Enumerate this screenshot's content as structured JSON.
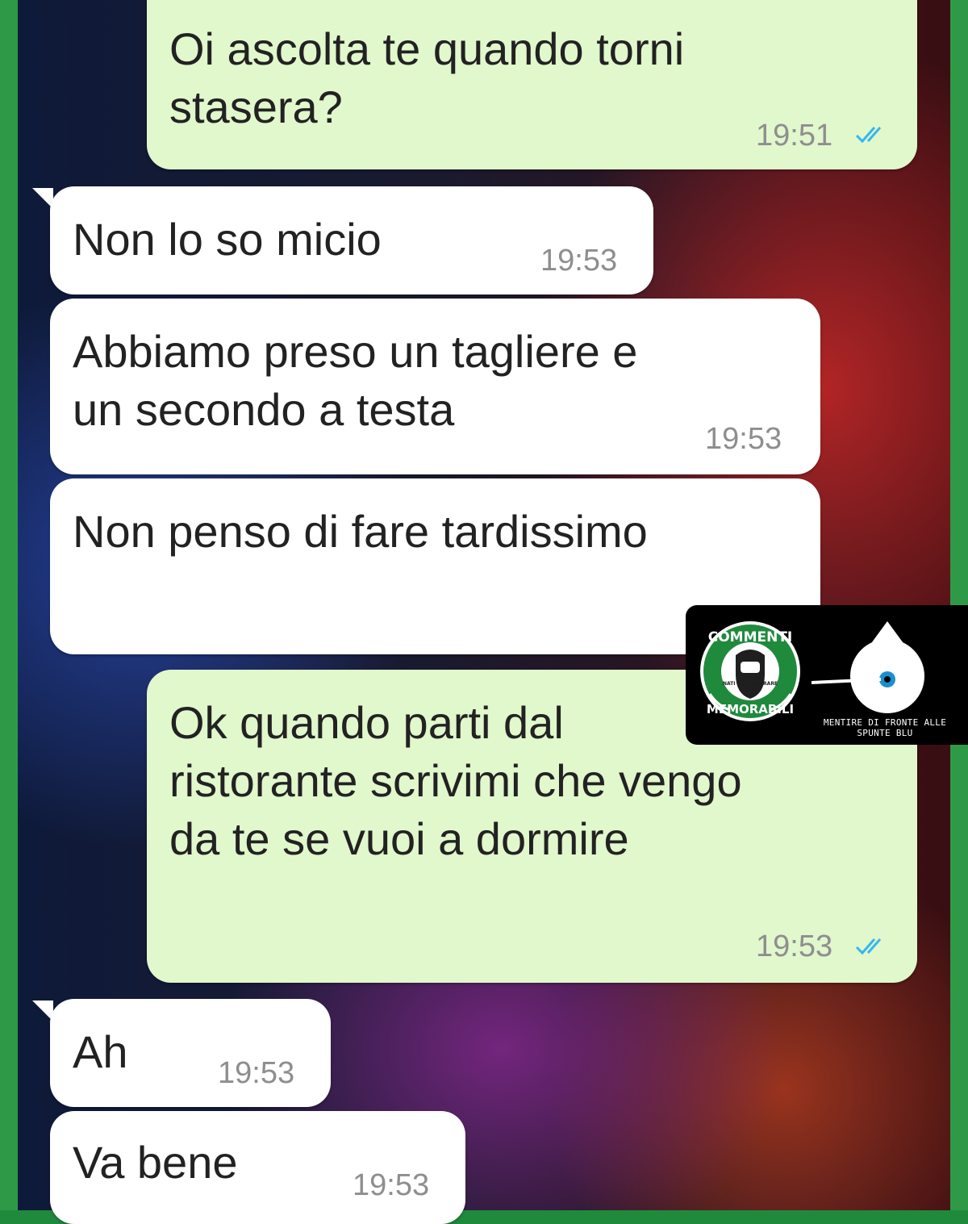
{
  "messages": [
    {
      "direction": "outgoing",
      "text": "Oi ascolta te quando torni\nstasera?",
      "time": "19:51",
      "read_ticks": "double-check-blue-icon"
    },
    {
      "direction": "incoming",
      "text": "Non lo so micio",
      "time": "19:53"
    },
    {
      "direction": "incoming",
      "text": "Abbiamo preso un tagliere e\nun secondo a testa",
      "time": "19:53"
    },
    {
      "direction": "incoming",
      "text": "Non penso di fare tardissimo",
      "time": ""
    },
    {
      "direction": "outgoing",
      "text": "Ok quando parti dal\nristorante scrivimi che vengo\nda te se vuoi a dormire",
      "time": "19:53",
      "read_ticks": "double-check-blue-icon"
    },
    {
      "direction": "incoming",
      "text": "Ah",
      "time": "19:53"
    },
    {
      "direction": "incoming",
      "text": "Va bene",
      "time": "19:53"
    }
  ],
  "watermark": {
    "badge_top": "COMMENTI",
    "badge_bottom": "MEMORABILI",
    "badge_center": "NATI PER IGNORARE",
    "caption": "MENTIRE DI FRONTE ALLE SPUNTE BLU"
  },
  "colors": {
    "outgoing_bubble": "#e1f7cc",
    "incoming_bubble": "#ffffff",
    "tick_blue": "#34b7f1",
    "frame_green": "#2e9a48"
  }
}
